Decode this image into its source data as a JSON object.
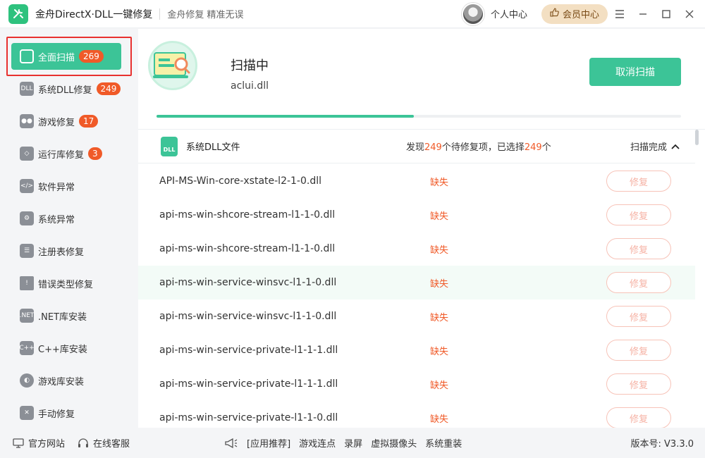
{
  "app": {
    "title": "金舟DirectX·DLL一键修复",
    "slogan": "金舟修复 精准无误",
    "personal_center": "个人中心",
    "vip_center": "会员中心"
  },
  "sidebar": {
    "items": [
      {
        "label": "全面扫描",
        "badge": "269",
        "icon": "fullscan-icon"
      },
      {
        "label": "系统DLL修复",
        "badge": "249",
        "icon": "dll-icon"
      },
      {
        "label": "游戏修复",
        "badge": "17",
        "icon": "gamepad-icon"
      },
      {
        "label": "运行库修复",
        "badge": "3",
        "icon": "runtime-icon"
      },
      {
        "label": "软件异常",
        "badge": "",
        "icon": "code-icon"
      },
      {
        "label": "系统异常",
        "badge": "",
        "icon": "gear-icon"
      },
      {
        "label": "注册表修复",
        "badge": "",
        "icon": "list-icon"
      },
      {
        "label": "错误类型修复",
        "badge": "",
        "icon": "warning-icon"
      },
      {
        "label": ".NET库安装",
        "badge": "",
        "icon": "dotnet-icon"
      },
      {
        "label": "C++库安装",
        "badge": "",
        "icon": "cpp-icon"
      },
      {
        "label": "游戏库安装",
        "badge": "",
        "icon": "pacman-icon"
      },
      {
        "label": "手动修复",
        "badge": "",
        "icon": "tools-icon"
      }
    ]
  },
  "scan": {
    "status": "扫描中",
    "current_file": "aclui.dll",
    "cancel_label": "取消扫描",
    "progress": 0.49
  },
  "group": {
    "icon_text": "DLL",
    "title": "系统DLL文件",
    "summary_prefix": "发现",
    "found": "249",
    "summary_mid": "个待修复项，已选择",
    "selected": "249",
    "summary_suffix": "个",
    "status": "扫描完成"
  },
  "rows": [
    {
      "name": "API-MS-Win-core-xstate-l2-1-0.dll",
      "status": "缺失",
      "action": "修复"
    },
    {
      "name": "api-ms-win-shcore-stream-l1-1-0.dll",
      "status": "缺失",
      "action": "修复"
    },
    {
      "name": "api-ms-win-shcore-stream-l1-1-0.dll",
      "status": "缺失",
      "action": "修复"
    },
    {
      "name": "api-ms-win-service-winsvc-l1-1-0.dll",
      "status": "缺失",
      "action": "修复"
    },
    {
      "name": "api-ms-win-service-winsvc-l1-1-0.dll",
      "status": "缺失",
      "action": "修复"
    },
    {
      "name": "api-ms-win-service-private-l1-1-1.dll",
      "status": "缺失",
      "action": "修复"
    },
    {
      "name": "api-ms-win-service-private-l1-1-1.dll",
      "status": "缺失",
      "action": "修复"
    },
    {
      "name": "api-ms-win-service-private-l1-1-0.dll",
      "status": "缺失",
      "action": "修复"
    }
  ],
  "footer": {
    "official_site": "官方网站",
    "online_service": "在线客服",
    "promo_label": "[应用推荐]",
    "promos": [
      "游戏连点",
      "录屏",
      "虚拟摄像头",
      "系统重装"
    ],
    "version": "版本号: V3.3.0"
  },
  "colors": {
    "accent": "#3cc497",
    "badge": "#f05a28",
    "highlight": "#e8312f",
    "vip": "#f3dfc2"
  }
}
